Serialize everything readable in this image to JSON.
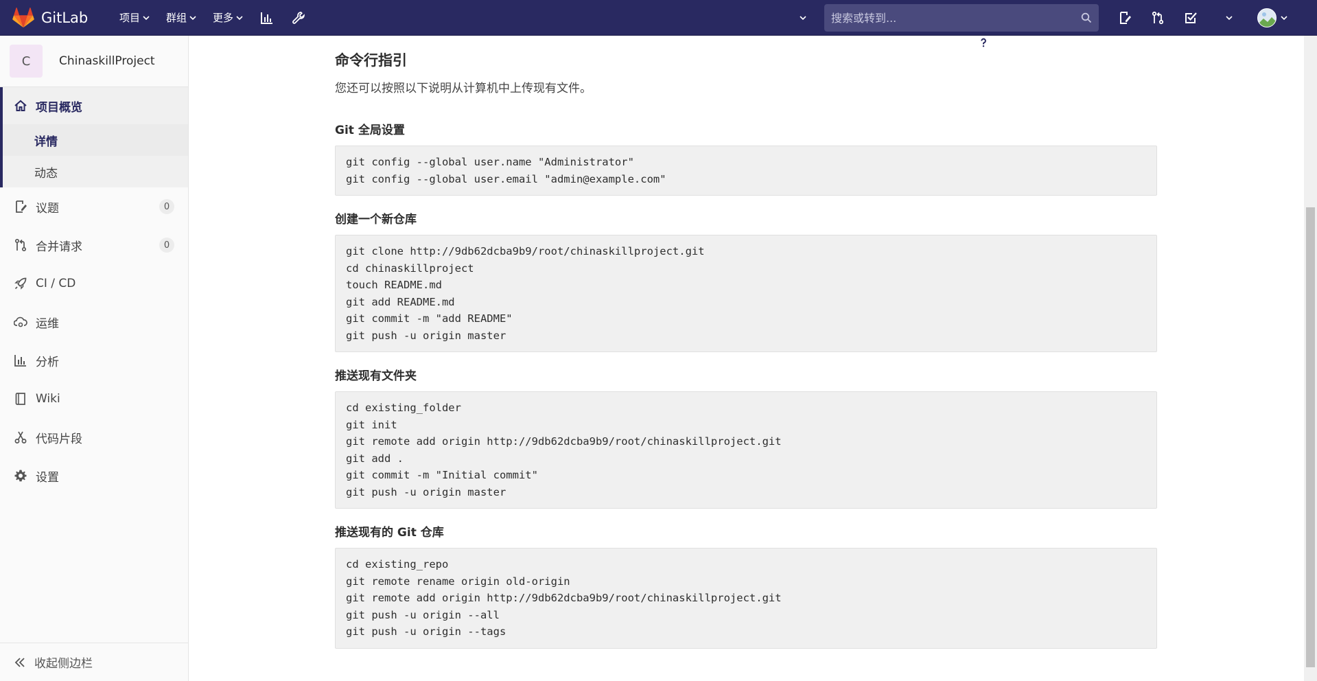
{
  "navbar": {
    "brand": "GitLab",
    "menu": [
      {
        "label": "项目"
      },
      {
        "label": "群组"
      },
      {
        "label": "更多"
      }
    ],
    "search_placeholder": "搜索或转到..."
  },
  "sidebar": {
    "project_initial": "C",
    "project_name": "ChinaskillProject",
    "overview": {
      "label": "项目概览",
      "sub": [
        "详情",
        "动态"
      ]
    },
    "items": [
      {
        "label": "议题",
        "count": "0"
      },
      {
        "label": "合并请求",
        "count": "0"
      },
      {
        "label": "CI / CD"
      },
      {
        "label": "运维"
      },
      {
        "label": "分析"
      },
      {
        "label": "Wiki"
      },
      {
        "label": "代码片段"
      },
      {
        "label": "设置"
      }
    ],
    "collapse_label": "收起侧边栏"
  },
  "main": {
    "title": "命令行指引",
    "lead": "您还可以按照以下说明从计算机中上传现有文件。",
    "sections": [
      {
        "title": "Git 全局设置",
        "code": "git config --global user.name \"Administrator\"\ngit config --global user.email \"admin@example.com\""
      },
      {
        "title": "创建一个新仓库",
        "code": "git clone http://9db62dcba9b9/root/chinaskillproject.git\ncd chinaskillproject\ntouch README.md\ngit add README.md\ngit commit -m \"add README\"\ngit push -u origin master"
      },
      {
        "title": "推送现有文件夹",
        "code": "cd existing_folder\ngit init\ngit remote add origin http://9db62dcba9b9/root/chinaskillproject.git\ngit add .\ngit commit -m \"Initial commit\"\ngit push -u origin master"
      },
      {
        "title": "推送现有的 Git 仓库",
        "code": "cd existing_repo\ngit remote rename origin old-origin\ngit remote add origin http://9db62dcba9b9/root/chinaskillproject.git\ngit push -u origin --all\ngit push -u origin --tags"
      }
    ]
  },
  "colors": {
    "navbar_bg": "#292961",
    "search_bg": "#4a4a7d",
    "sidebar_bg": "#fafafa",
    "code_bg": "#f0f0f0",
    "logo_orange": "#fc6d26"
  }
}
